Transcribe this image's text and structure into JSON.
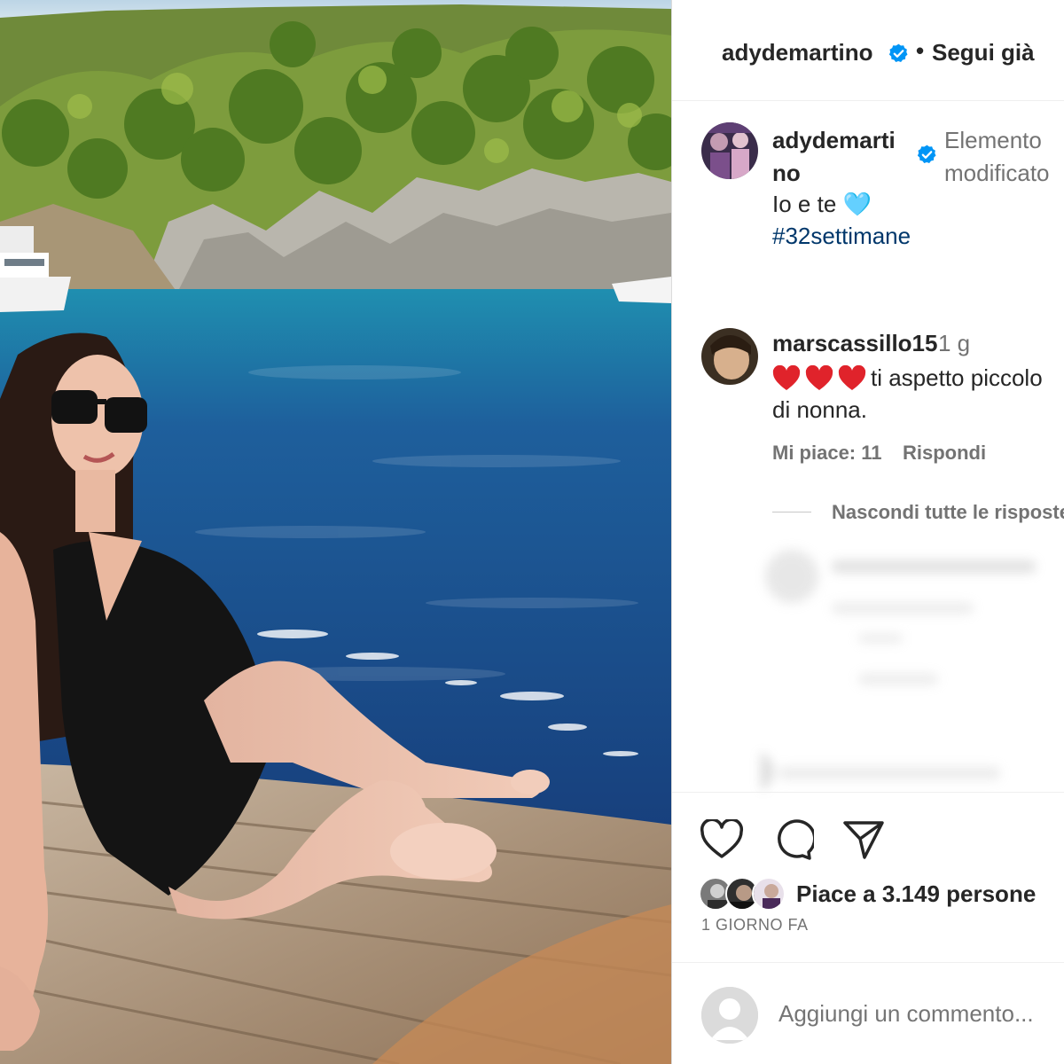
{
  "header": {
    "username": "adydemartino",
    "separator": "•",
    "follow_label": "Segui già",
    "verified_icon": "verified-badge-icon"
  },
  "caption": {
    "username": "adydemartino",
    "edited_label": "Elemento modificato",
    "text": "Io e te 🩵",
    "hashtag": "#32settimane"
  },
  "comment": {
    "username": "marscassillo15",
    "time": "1 g",
    "text_line1": "ti aspetto piccolo",
    "text_line2": "di nonna.",
    "likes": "Mi piace: 11",
    "reply_label": "Rispondi",
    "hearts": [
      "heart-emoji",
      "heart-emoji",
      "heart-emoji"
    ]
  },
  "replies": {
    "hide_label": "Nascondi tutte le risposte"
  },
  "post": {
    "likes_text": "Piace a 3.149 persone",
    "date": "1 GIORNO FA",
    "actions": [
      "like-icon",
      "comment-icon",
      "share-icon"
    ]
  },
  "add_comment": {
    "placeholder": "Aggiungi un commento..."
  },
  "colors": {
    "verified": "#0095f6",
    "heart": "#e0232b",
    "link": "#00376b",
    "muted": "#737373",
    "text": "#262626"
  }
}
